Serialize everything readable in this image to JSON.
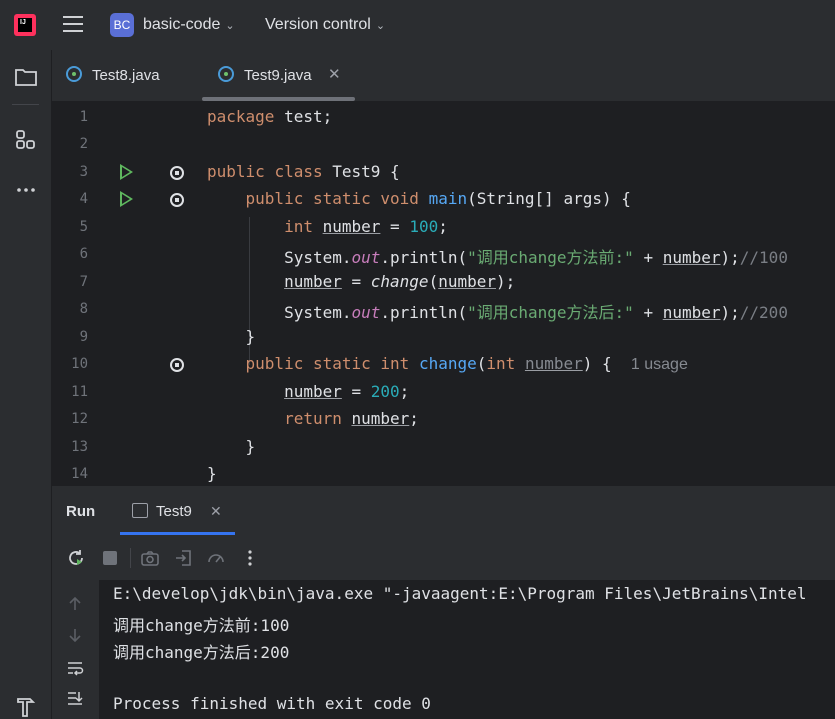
{
  "header": {
    "project_badge": "BC",
    "project_name": "basic-code",
    "vcs_label": "Version control"
  },
  "tabs": [
    {
      "label": "Test8.java"
    },
    {
      "label": "Test9.java"
    }
  ],
  "code_lines": [
    {
      "n": "1"
    },
    {
      "n": "2"
    },
    {
      "n": "3"
    },
    {
      "n": "4"
    },
    {
      "n": "5"
    },
    {
      "n": "6"
    },
    {
      "n": "7"
    },
    {
      "n": "8"
    },
    {
      "n": "9"
    },
    {
      "n": "10"
    },
    {
      "n": "11"
    },
    {
      "n": "12"
    },
    {
      "n": "13"
    },
    {
      "n": "14"
    }
  ],
  "code": {
    "l1": {
      "kw": "package",
      "rest": " test;"
    },
    "l3": {
      "kw1": "public",
      "kw2": "class",
      "rest": " Test9 {"
    },
    "l4": {
      "kw1": "public",
      "kw2": "static",
      "kw3": "void",
      "fn": "main",
      "rest": "(String[] args) {"
    },
    "l5": {
      "kw": "int",
      "var": "number",
      "eq": " = ",
      "num": "100",
      "end": ";"
    },
    "l6": {
      "pre": "System.",
      "st": "out",
      "mid": ".println(",
      "str": "\"调用change方法前:\"",
      "plus": " + ",
      "var": "number",
      "end": ");",
      "cm": "//100"
    },
    "l7": {
      "var": "number",
      "eq": " = ",
      "call": "change",
      "open": "(",
      "arg": "number",
      "end": ");"
    },
    "l8": {
      "pre": "System.",
      "st": "out",
      "mid": ".println(",
      "str": "\"调用change方法后:\"",
      "plus": " + ",
      "var": "number",
      "end": ");",
      "cm": "//200"
    },
    "l9": {
      "text": "}"
    },
    "l10": {
      "kw1": "public",
      "kw2": "static",
      "kw3": "int",
      "fn": "change",
      "open": "(",
      "kw4": "int",
      "param": "number",
      "end": ") {",
      "hint": "1 usage"
    },
    "l11": {
      "var": "number",
      "eq": " = ",
      "num": "200",
      "end": ";"
    },
    "l12": {
      "kw": "return",
      "var": "number",
      "end": ";"
    },
    "l13": {
      "text": "}"
    },
    "l14": {
      "text": "}"
    }
  },
  "run_panel": {
    "title": "Run",
    "tab_label": "Test9"
  },
  "console": {
    "lines": [
      "E:\\develop\\jdk\\bin\\java.exe \"-javaagent:E:\\Program Files\\JetBrains\\Intel",
      "调用change方法前:100",
      "调用change方法后:200",
      "",
      "Process finished with exit code 0"
    ]
  }
}
